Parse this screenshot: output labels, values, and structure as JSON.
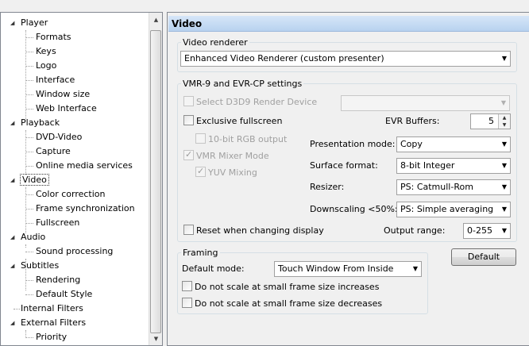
{
  "tree": {
    "items": [
      {
        "label": "Player",
        "expander": "◢"
      },
      {
        "label": "Formats"
      },
      {
        "label": "Keys"
      },
      {
        "label": "Logo"
      },
      {
        "label": "Interface"
      },
      {
        "label": "Window size"
      },
      {
        "label": "Web Interface"
      },
      {
        "label": "Playback",
        "expander": "◢"
      },
      {
        "label": "DVD-Video"
      },
      {
        "label": "Capture"
      },
      {
        "label": "Online media services"
      },
      {
        "label": "Video",
        "expander": "◢",
        "selected": true
      },
      {
        "label": "Color correction"
      },
      {
        "label": "Frame synchronization"
      },
      {
        "label": "Fullscreen"
      },
      {
        "label": "Audio",
        "expander": "◢"
      },
      {
        "label": "Sound processing"
      },
      {
        "label": "Subtitles",
        "expander": "◢"
      },
      {
        "label": "Rendering"
      },
      {
        "label": "Default Style"
      },
      {
        "label": "Internal Filters"
      },
      {
        "label": "External Filters",
        "expander": "◢"
      },
      {
        "label": "Priority"
      }
    ]
  },
  "page": {
    "title": "Video"
  },
  "video_renderer": {
    "group_title": "Video renderer",
    "selected": "Enhanced Video Renderer (custom presenter)"
  },
  "vmr": {
    "group_title": "VMR-9 and EVR-CP settings",
    "select_d3d9": "Select D3D9 Render Device",
    "d3d9_device": "",
    "exclusive_fullscreen": "Exclusive fullscreen",
    "rgb_output": "10-bit RGB output",
    "vmr_mixer_mode": "VMR Mixer Mode",
    "yuv_mixing": "YUV Mixing",
    "evr_buffers_label": "EVR Buffers:",
    "evr_buffers_value": "5",
    "presentation_mode_label": "Presentation mode:",
    "presentation_mode_value": "Copy",
    "surface_format_label": "Surface format:",
    "surface_format_value": "8-bit Integer",
    "resizer_label": "Resizer:",
    "resizer_value": "PS: Catmull-Rom",
    "downscaling_label": "Downscaling <50%:",
    "downscaling_value": "PS: Simple averaging",
    "reset_on_display_change": "Reset when changing display",
    "output_range_label": "Output range:",
    "output_range_value": "0-255"
  },
  "framing": {
    "group_title": "Framing",
    "default_mode_label": "Default mode:",
    "default_mode_value": "Touch Window From Inside",
    "no_scale_increase": "Do not scale at small frame size increases",
    "no_scale_decrease": "Do not scale at small frame size decreases"
  },
  "buttons": {
    "default": "Default"
  }
}
